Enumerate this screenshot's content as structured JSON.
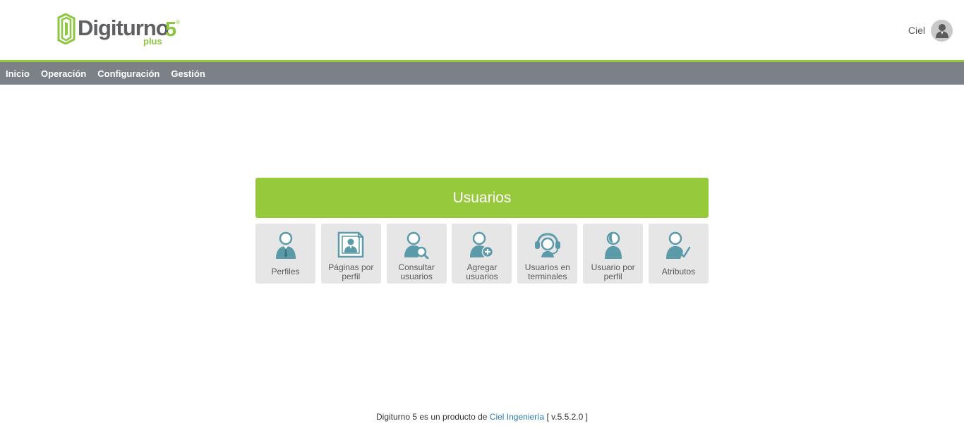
{
  "header": {
    "logo_text": "Digiturno",
    "logo_number": "5",
    "logo_reg": "®",
    "logo_plus": "plus",
    "user_name": "Ciel"
  },
  "nav": {
    "items": [
      "Inicio",
      "Operación",
      "Configuración",
      "Gestión"
    ]
  },
  "panel": {
    "title": "Usuarios",
    "tiles": [
      {
        "label": "Perfiles",
        "icon": "user-tie-icon"
      },
      {
        "label": "Páginas por perfil",
        "icon": "profile-page-icon"
      },
      {
        "label": "Consultar usuarios",
        "icon": "user-search-icon"
      },
      {
        "label": "Agregar usuarios",
        "icon": "user-add-icon"
      },
      {
        "label": "Usuarios en terminales",
        "icon": "headset-user-icon"
      },
      {
        "label": "Usuario por perfil",
        "icon": "user-profile-icon"
      },
      {
        "label": "Atributos",
        "icon": "user-check-icon"
      }
    ]
  },
  "footer": {
    "prefix": "Digiturno 5 es un producto de ",
    "link": "Ciel Ingeniería",
    "suffix": " [ v.5.5.2.0 ]"
  },
  "colors": {
    "accent_green": "#97c93d",
    "nav_gray": "#7b8187",
    "tile_bg": "#e6e6e6",
    "icon_teal": "#5b9aa9",
    "link_blue": "#2a7ab0"
  }
}
